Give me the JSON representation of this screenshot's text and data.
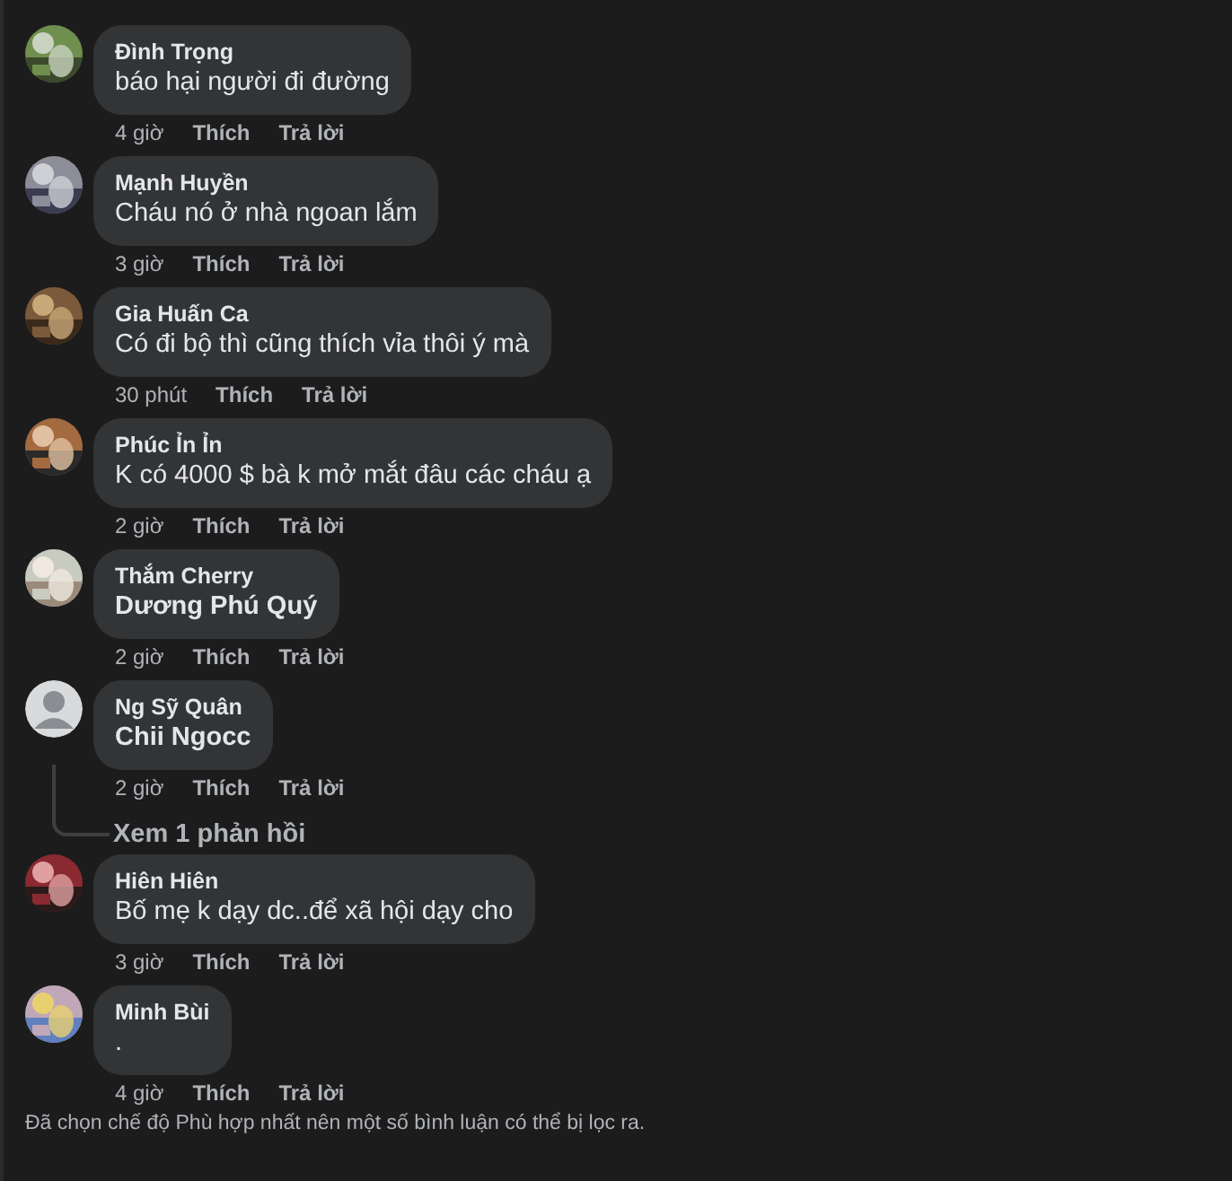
{
  "comments": [
    {
      "author": "Đình Trọng",
      "text": "báo hại người đi đường",
      "bold_text": false,
      "kind": "picture",
      "time": "4 giờ",
      "like": "Thích",
      "reply": "Trả lời"
    },
    {
      "author": "Mạnh Huyền",
      "text": "Cháu nó ở nhà ngoan lắm",
      "bold_text": false,
      "kind": "picture",
      "time": "3 giờ",
      "like": "Thích",
      "reply": "Trả lời"
    },
    {
      "author": "Gia Huấn Ca",
      "text": "Có đi bộ thì cũng thích vỉa thôi ý mà",
      "bold_text": false,
      "kind": "picture",
      "time": "30 phút",
      "like": "Thích",
      "reply": "Trả lời"
    },
    {
      "author": "Phúc Ỉn Ỉn",
      "text": "K có 4000 $ bà k mở mắt đâu các cháu ạ",
      "bold_text": false,
      "kind": "picture",
      "time": "2 giờ",
      "like": "Thích",
      "reply": "Trả lời"
    },
    {
      "author": "Thắm Cherry",
      "text": "Dương Phú Quý",
      "bold_text": true,
      "kind": "picture",
      "time": "2 giờ",
      "like": "Thích",
      "reply": "Trả lời"
    },
    {
      "author": "Ng Sỹ Quân",
      "text": "Chii Ngocc",
      "bold_text": true,
      "kind": "default",
      "time": "2 giờ",
      "like": "Thích",
      "reply": "Trả lời",
      "replies_link": "Xem 1 phản hồi"
    },
    {
      "author": "Hiên Hiên",
      "text": "Bố mẹ k dạy dc..để xã hội dạy cho",
      "bold_text": false,
      "kind": "picture",
      "time": "3 giờ",
      "like": "Thích",
      "reply": "Trả lời"
    },
    {
      "author": "Minh Bùi",
      "text": ".",
      "bold_text": false,
      "kind": "picture",
      "time": "4 giờ",
      "like": "Thích",
      "reply": "Trả lời"
    }
  ],
  "footer_note": "Đã chọn chế độ Phù hợp nhất nên một số bình luận có thể bị lọc ra."
}
